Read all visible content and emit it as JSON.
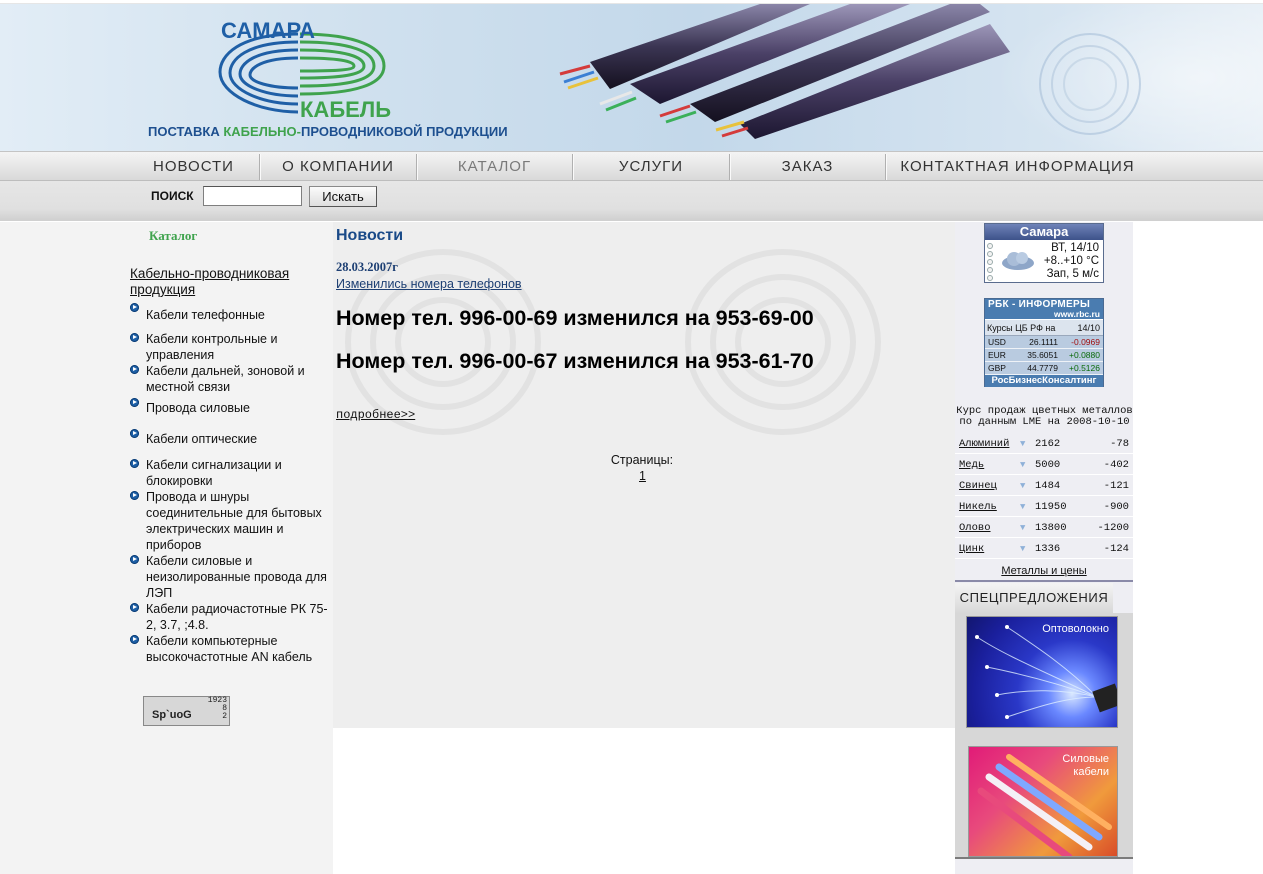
{
  "header": {
    "logo_top": "САМАРА",
    "logo_bottom": "КАБЕЛЬ",
    "tagline_part1": "ПОСТАВКА ",
    "tagline_part2": "КАБЕЛЬНО-",
    "tagline_part3": "ПРОВОДНИКОВОЙ ПРОДУКЦИИ"
  },
  "nav": {
    "items": [
      {
        "label": "НОВОСТИ"
      },
      {
        "label": "О КОМПАНИИ"
      },
      {
        "label": "КАТАЛОГ",
        "active": true
      },
      {
        "label": "УСЛУГИ"
      },
      {
        "label": "ЗАКАЗ"
      },
      {
        "label": "КОНТАКТНАЯ ИНФОРМАЦИЯ"
      }
    ]
  },
  "search": {
    "label": "ПОИСК",
    "value": "",
    "button": "Искать"
  },
  "sidebar": {
    "title": "Каталог",
    "heading": "Кабельно-проводниковая продукция",
    "items": [
      {
        "label": "Кабели телефонные"
      },
      {
        "label": "Кабели контрольные и управления"
      },
      {
        "label": "Кабели дальней, зоновой и местной связи"
      },
      {
        "label": "Провода силовые"
      },
      {
        "label": "Кабели оптические"
      },
      {
        "label": "Кабели сигнализации и блокировки"
      },
      {
        "label": "Провода и шнуры соединительные для бытовых электрических машин и приборов"
      },
      {
        "label": "Кабели силовые и неизолированные провода для ЛЭП"
      },
      {
        "label": "Кабели радиочастотные РК 75-2, 3.7, ;4.8."
      },
      {
        "label": "Кабели компьютерные высокочастотные AN кабель"
      }
    ],
    "counter": {
      "line1": "1923",
      "line2": "8",
      "line3": "2",
      "brand": "Sp`uoG"
    }
  },
  "news": {
    "title": "Новости",
    "date": "28.03.2007г",
    "link": "Изменились номера телефонов",
    "lines": [
      "Номер тел. 996-00-69 изменился на 953-69-00",
      "Номер тел. 996-00-67 изменился на 953-61-70"
    ],
    "more": "подробнее>>",
    "pages_label": "Страницы:",
    "page": "1"
  },
  "weather": {
    "city": "Самара",
    "date": "ВТ, 14/10",
    "temp": "+8..+10 °C",
    "wind": "Зап, 5 м/с"
  },
  "rbc": {
    "title": "РБК - ИНФОРМЕРЫ",
    "site": "www.rbc.ru",
    "rates_label": "Курсы ЦБ РФ на",
    "rates_date": "14/10",
    "rates": [
      {
        "cur": "USD",
        "value": "26.1111",
        "change": "-0.0969"
      },
      {
        "cur": "EUR",
        "value": "35.6051",
        "change": "+0.0880"
      },
      {
        "cur": "GBP",
        "value": "44.7779",
        "change": "+0.5126"
      }
    ],
    "footer": "РосБизнесКонсалтинг"
  },
  "metals": {
    "title_line1": "Курс продаж цветных металлов",
    "title_line2": "по данным LME на 2008-10-10",
    "rows": [
      {
        "name": "Алюминий",
        "price": "2162",
        "delta": "-78"
      },
      {
        "name": "Медь",
        "price": "5000",
        "delta": "-402"
      },
      {
        "name": "Свинец",
        "price": "1484",
        "delta": "-121"
      },
      {
        "name": "Никель",
        "price": "11950",
        "delta": "-900"
      },
      {
        "name": "Олово",
        "price": "13800",
        "delta": "-1200"
      },
      {
        "name": "Цинк",
        "price": "1336",
        "delta": "-124"
      }
    ],
    "link": "Металлы и цены"
  },
  "special": {
    "title": "СПЕЦПРЕДЛОЖЕНИЯ",
    "promo1": "Оптоволокно",
    "promo2_line1": "Силовые",
    "promo2_line2": "кабели"
  }
}
